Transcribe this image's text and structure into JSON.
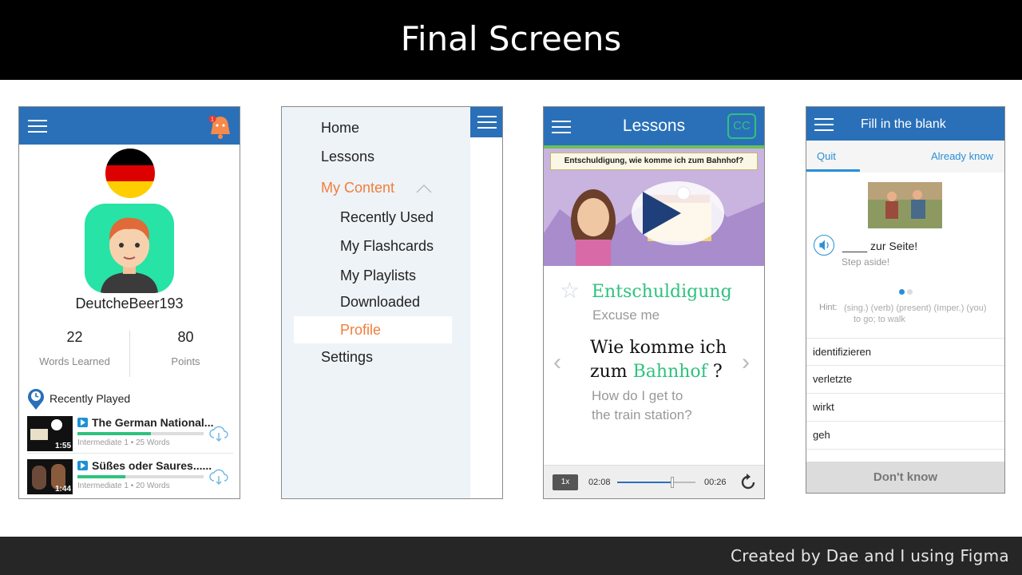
{
  "slide": {
    "title": "Final Screens",
    "credit": "Created by Dae and I using Figma"
  },
  "profile_screen": {
    "username": "DeutcheBeer193",
    "stats": [
      {
        "value": "22",
        "label": "Words Learned"
      },
      {
        "value": "80",
        "label": "Points"
      }
    ],
    "recently_played_label": "Recently Played",
    "notification_count": "1",
    "videos": [
      {
        "title": "The German National...",
        "duration": "1:55",
        "level": "Intermediate 1",
        "words": "25 Words",
        "progress": 0.58
      },
      {
        "title": "Süßes oder Saures......",
        "duration": "1:44",
        "level": "Intermediate 1",
        "words": "20 Words",
        "progress": 0.38
      }
    ]
  },
  "menu_screen": {
    "items": [
      "Home",
      "Lessons",
      "My Content",
      "Recently Used",
      "My Flashcards",
      "My Playlists",
      "Downloaded",
      "Profile",
      "Settings"
    ]
  },
  "lesson_screen": {
    "title": "Lessons",
    "cc_label": "CC",
    "video_caption": "Entschuldigung, wie komme ich zum Bahnhof?",
    "word": "Entschuldigung",
    "word_translation": "Excuse me",
    "sentence_part1": "Wie komme ich",
    "sentence_part2": "zum",
    "sentence_highlight": "Bahnhof",
    "sentence_end": "?",
    "sentence_translation_1": "How do I get to",
    "sentence_translation_2": "the train station?",
    "speed": "1x",
    "time_current": "02:08",
    "time_total": "00:26",
    "progress": 0.7
  },
  "quiz_screen": {
    "title": "Fill in the blank",
    "tab_quit": "Quit",
    "tab_know": "Already know",
    "blank_sentence": "____ zur Seite!",
    "blank_translation": "Step aside!",
    "hint_label": "Hint:",
    "hint_line1": "(sing.) (verb) (present) (Imper.) (you)",
    "hint_line2": "to go; to walk",
    "options": [
      "identifizieren",
      "verletzte",
      "wirkt",
      "geh"
    ],
    "dont_know": "Don't know"
  },
  "colors": {
    "primary_blue": "#2a70b8",
    "accent_green": "#2ec27e",
    "accent_orange": "#f27d3a"
  }
}
